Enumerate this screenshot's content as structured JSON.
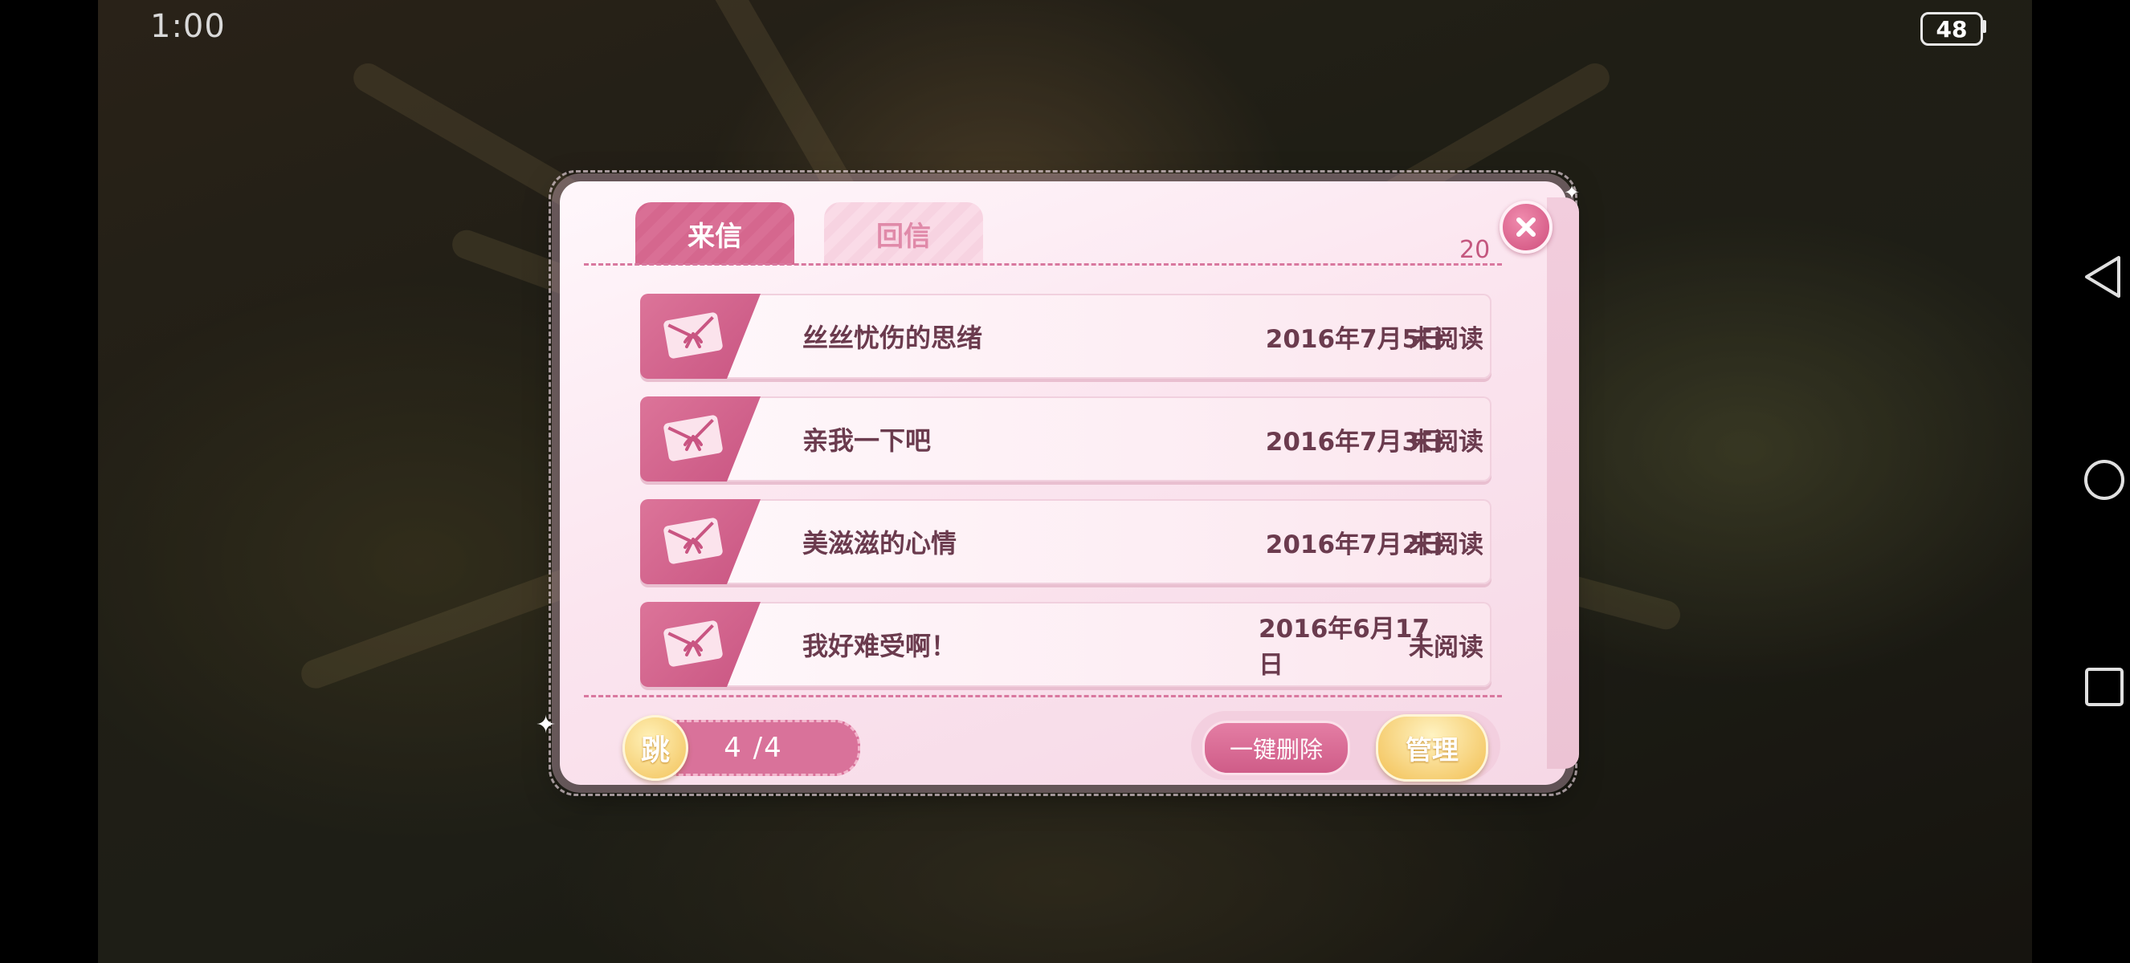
{
  "status_bar": {
    "time": "1:00",
    "battery": "48"
  },
  "mailbox": {
    "tabs": [
      {
        "label": "来信",
        "active": true
      },
      {
        "label": "回信",
        "active": false
      }
    ],
    "count": "20",
    "letters": [
      {
        "title": "丝丝忧伤的思绪",
        "date": "2016年7月5日",
        "status": "未阅读"
      },
      {
        "title": "亲我一下吧",
        "date": "2016年7月3日",
        "status": "未阅读"
      },
      {
        "title": "美滋滋的心情",
        "date": "2016年7月2日",
        "status": "未阅读"
      },
      {
        "title": "我好难受啊！",
        "date": "2016年6月17日",
        "status": "未阅读"
      }
    ],
    "jump_label": "跳",
    "page": "4 /4",
    "delete_all_label": "一键删除",
    "manage_label": "管理"
  },
  "colors": {
    "accent_pink": "#d5678e",
    "panel": "#fbe5ef",
    "gold": "#f2c25a"
  },
  "icons": [
    "close-icon",
    "letter-icon",
    "back-icon",
    "home-icon",
    "recent-apps-icon",
    "sparkle-icon"
  ]
}
